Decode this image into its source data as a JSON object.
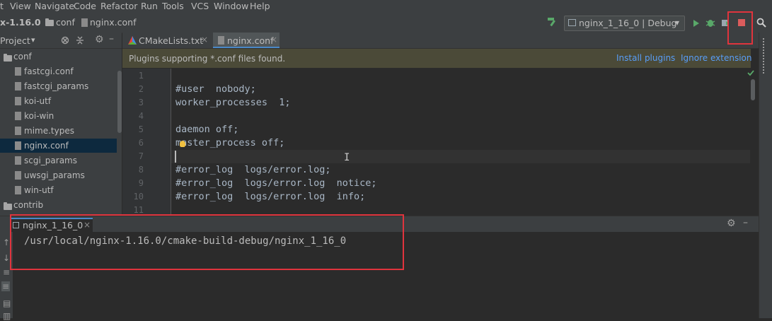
{
  "menubar": {
    "items": [
      "t",
      "View",
      "Navigate",
      "Code",
      "Refactor",
      "Run",
      "Tools",
      "VCS",
      "Window",
      "Help"
    ]
  },
  "breadcrumbs": {
    "project": "x-1.16.0",
    "folder": "conf",
    "file": "nginx.conf"
  },
  "run_config": {
    "label": "nginx_1_16_0 | Debug",
    "dropdown_glyph": "▾"
  },
  "toolbar_icons": [
    "hammer-icon",
    "run-icon",
    "debug-icon",
    "coverage-icon",
    "stop-icon",
    "search-icon"
  ],
  "project_panel": {
    "title": "Project",
    "title_arrow": "▾",
    "tree": [
      {
        "label": "conf",
        "type": "folder",
        "indent": 0
      },
      {
        "label": "fastcgi.conf",
        "type": "file",
        "indent": 1
      },
      {
        "label": "fastcgi_params",
        "type": "file",
        "indent": 1
      },
      {
        "label": "koi-utf",
        "type": "file",
        "indent": 1
      },
      {
        "label": "koi-win",
        "type": "file",
        "indent": 1
      },
      {
        "label": "mime.types",
        "type": "file",
        "indent": 1
      },
      {
        "label": "nginx.conf",
        "type": "file",
        "indent": 1,
        "selected": true
      },
      {
        "label": "scgi_params",
        "type": "file",
        "indent": 1
      },
      {
        "label": "uwsgi_params",
        "type": "file",
        "indent": 1
      },
      {
        "label": "win-utf",
        "type": "file",
        "indent": 1
      },
      {
        "label": "contrib",
        "type": "folder",
        "indent": 0
      }
    ]
  },
  "editor_tabs": [
    {
      "label": "CMakeLists.txt",
      "active": false
    },
    {
      "label": "nginx.conf",
      "active": true
    }
  ],
  "notification": {
    "message": "Plugins supporting *.conf files found.",
    "install": "Install plugins",
    "ignore": "Ignore extension"
  },
  "editor": {
    "line_numbers": [
      "1",
      "2",
      "3",
      "4",
      "5",
      "6",
      "7",
      "8",
      "9",
      "10",
      "11"
    ],
    "lines": [
      "",
      "#user  nobody;",
      "worker_processes  1;",
      "",
      "daemon off;",
      "master_process off;",
      "",
      "#error_log  logs/error.log;",
      "#error_log  logs/error.log  notice;",
      "#error_log  logs/error.log  info;",
      ""
    ],
    "caret_line": 7,
    "text_cursor_glyph": "I"
  },
  "run_panel": {
    "tab_label": "nginx_1_16_0",
    "tab_close": "×",
    "output": "/usr/local/nginx-1.16.0/cmake-build-debug/nginx_1_16_0",
    "settings_glyph": "⚙",
    "minimize_glyph": "–"
  },
  "colors": {
    "highlight": "#e0343d",
    "selection": "#0d293e",
    "link": "#589df6",
    "run_green": "#59a869"
  }
}
